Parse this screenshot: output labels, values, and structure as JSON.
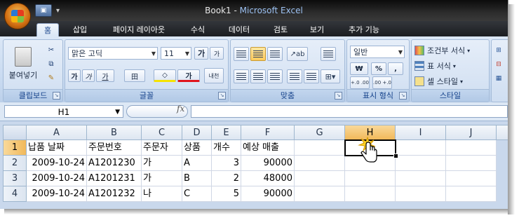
{
  "window": {
    "title_doc": "Book1",
    "title_sep": " - ",
    "title_app": "Microsoft Excel"
  },
  "quick_access": {
    "camera_label": "",
    "dropdown_glyph": "▾"
  },
  "ribbon_tabs": [
    {
      "label": "홈",
      "active": true
    },
    {
      "label": "삽입"
    },
    {
      "label": "페이지 레이아웃"
    },
    {
      "label": "수식"
    },
    {
      "label": "데이터"
    },
    {
      "label": "검토"
    },
    {
      "label": "보기"
    },
    {
      "label": "추가 기능"
    }
  ],
  "clipboard": {
    "paste_label": "붙여넣기",
    "group_label": "클립보드"
  },
  "font": {
    "font_name": "맑은 고딕",
    "font_size": "11",
    "grow_label": "가",
    "shrink_label": "가",
    "bold": "가",
    "italic": "가",
    "underline": "가",
    "border_label": "田",
    "fill_label": "◇",
    "color_label": "가",
    "phonetic_label": "내천",
    "group_label": "글꼴"
  },
  "alignment": {
    "group_label": "맞춤"
  },
  "number": {
    "format": "일반",
    "currency": "₩",
    "percent": "%",
    "comma": ",",
    "dec_inc": "+.0 .00",
    "dec_dec": ".00 +.0",
    "group_label": "표시 형식"
  },
  "styles": {
    "conditional": "조건부 서식",
    "table": "표 서식",
    "cell": "셀 스타일",
    "group_label": "스타일"
  },
  "formula_bar": {
    "name_box": "H1",
    "fx": "fx",
    "formula": ""
  },
  "grid": {
    "columns": [
      "A",
      "B",
      "C",
      "D",
      "E",
      "F",
      "G",
      "H",
      "I",
      "J"
    ],
    "rows": [
      "1",
      "2",
      "3",
      "4"
    ],
    "selected_column": "H",
    "selected_row": "1",
    "cells": [
      [
        "납품 날짜",
        "주문번호",
        "주문자",
        "상품",
        "개수",
        "예상 매출",
        "",
        "",
        "",
        ""
      ],
      [
        "2009-10-24",
        "A1201230",
        "가",
        "A",
        "3",
        "90000",
        "",
        "",
        "",
        ""
      ],
      [
        "2009-10-24",
        "A1201231",
        "가",
        "B",
        "2",
        "48000",
        "",
        "",
        "",
        ""
      ],
      [
        "2009-10-24",
        "A1201232",
        "나",
        "C",
        "5",
        "90000",
        "",
        "",
        "",
        ""
      ]
    ]
  },
  "colors": {
    "title_bar": "#1b1d21",
    "ribbon": "#c7d9f0",
    "selected_header": "#f1b95a",
    "grid_line": "#d0d7e5"
  }
}
